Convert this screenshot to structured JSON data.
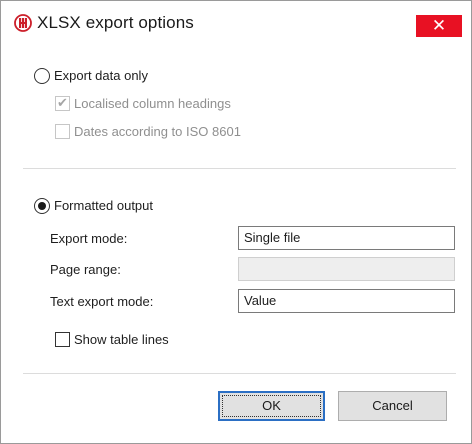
{
  "window": {
    "title": "XLSX export options",
    "close_glyph": "✕",
    "app_icon": "hh-logo-icon",
    "accent_color": "#cc1f2a",
    "close_color": "#e81123"
  },
  "export_data_only": {
    "label": "Export data only",
    "selected": false,
    "options": [
      {
        "label": "Localised column headings",
        "checked": true,
        "enabled": false
      },
      {
        "label": "Dates according to ISO 8601",
        "checked": false,
        "enabled": false
      }
    ]
  },
  "formatted_output": {
    "label": "Formatted output",
    "selected": true,
    "fields": [
      {
        "label": "Export mode:",
        "value": "Single file",
        "enabled": true
      },
      {
        "label": "Page range:",
        "value": "",
        "enabled": false
      },
      {
        "label": "Text export mode:",
        "value": "Value",
        "enabled": true
      }
    ],
    "show_table_lines": {
      "label": "Show table lines",
      "checked": false
    }
  },
  "buttons": {
    "ok": "OK",
    "cancel": "Cancel"
  }
}
